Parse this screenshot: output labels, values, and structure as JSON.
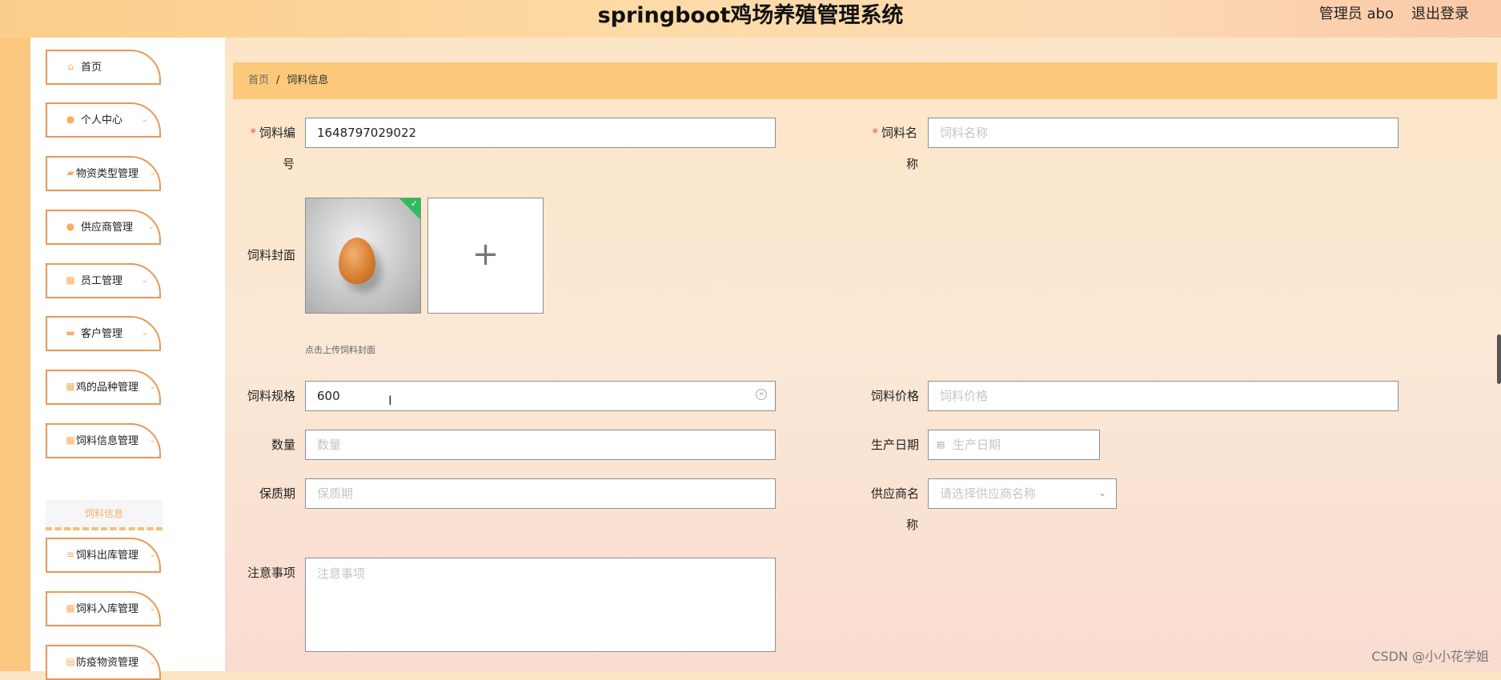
{
  "header": {
    "title": "springboot鸡场养殖管理系统",
    "user": "管理员 abo",
    "logout": "退出登录"
  },
  "sidebar": {
    "items": [
      {
        "label": "首页",
        "icon": "home-icon",
        "glyph": "⌂",
        "has_arrow": false
      },
      {
        "label": "个人中心",
        "icon": "user-icon",
        "glyph": "●",
        "has_arrow": true
      },
      {
        "label": "物资类型管理",
        "icon": "folder-icon",
        "glyph": "▰",
        "has_arrow": true
      },
      {
        "label": "供应商管理",
        "icon": "location-icon",
        "glyph": "●",
        "has_arrow": true
      },
      {
        "label": "员工管理",
        "icon": "grid-icon",
        "glyph": "▦",
        "has_arrow": true
      },
      {
        "label": "客户管理",
        "icon": "briefcase-icon",
        "glyph": "▬",
        "has_arrow": true
      },
      {
        "label": "鸡的品种管理",
        "icon": "grid-icon",
        "glyph": "▦",
        "has_arrow": true
      },
      {
        "label": "饲料信息管理",
        "icon": "grid-icon",
        "glyph": "▦",
        "has_arrow": true
      },
      {
        "label": "饲料出库管理",
        "icon": "sliders-icon",
        "glyph": "≡",
        "has_arrow": true
      },
      {
        "label": "饲料入库管理",
        "icon": "grid-icon",
        "glyph": "▦",
        "has_arrow": true
      },
      {
        "label": "防疫物资管理",
        "icon": "document-icon",
        "glyph": "▤",
        "has_arrow": true
      }
    ],
    "sub_item": "饲料信息",
    "arrow_glyph": "⌄"
  },
  "breadcrumb": {
    "home": "首页",
    "sep": "/",
    "current": "饲料信息"
  },
  "form": {
    "code_label_line1": "饲料编",
    "code_label_line2": "号",
    "code_value": "1648797029022",
    "name_label_line1": "饲料名",
    "name_label_line2": "称",
    "name_placeholder": "饲料名称",
    "cover_label": "饲料封面",
    "cover_hint": "点击上传饲料封面",
    "spec_label": "饲料规格",
    "spec_value": "600",
    "price_label": "饲料价格",
    "price_placeholder": "饲料价格",
    "qty_label": "数量",
    "qty_placeholder": "数量",
    "date_label": "生产日期",
    "date_placeholder": "生产日期",
    "shelf_label": "保质期",
    "shelf_placeholder": "保质期",
    "supplier_label_line1": "供应商名",
    "supplier_label_line2": "称",
    "supplier_placeholder": "请选择供应商名称",
    "notes_label": "注意事项",
    "notes_placeholder": "注意事项",
    "required_mark": "*",
    "plus": "+",
    "check": "✓",
    "clear": "×",
    "cursor": "I",
    "calendar": "▤",
    "select_arrow": "⌄"
  },
  "watermark": "CSDN @小小花学姐"
}
